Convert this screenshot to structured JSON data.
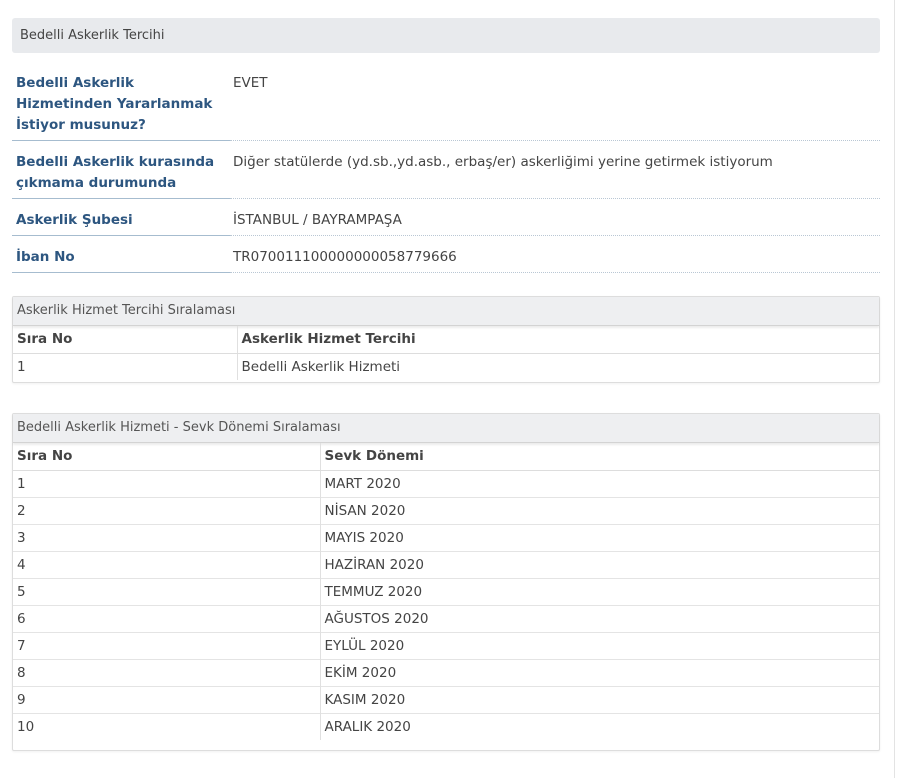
{
  "section": {
    "title": "Bedelli Askerlik Tercihi"
  },
  "fields": [
    {
      "label": "Bedelli Askerlik Hizmetinden Yararlanmak İstiyor musunuz?",
      "value": "EVET"
    },
    {
      "label": "Bedelli Askerlik kurasında çıkmama durumunda",
      "value": "Diğer statülerde (yd.sb.,yd.asb., erbaş/er) askerliğimi yerine getirmek istiyorum"
    },
    {
      "label": "Askerlik Şubesi",
      "value": "İSTANBUL / BAYRAMPAŞA"
    },
    {
      "label": "İban No",
      "value": "TR070011100000000058779666"
    }
  ],
  "service_preference": {
    "title": "Askerlik Hizmet Tercihi Sıralaması",
    "headers": [
      "Sıra No",
      "Askerlik Hizmet Tercihi"
    ],
    "rows": [
      [
        "1",
        "Bedelli Askerlik Hizmeti"
      ]
    ]
  },
  "dispatch_period": {
    "title": "Bedelli Askerlik Hizmeti - Sevk Dönemi Sıralaması",
    "headers": [
      "Sıra No",
      "Sevk Dönemi"
    ],
    "rows": [
      [
        "1",
        "MART 2020"
      ],
      [
        "2",
        "NİSAN 2020"
      ],
      [
        "3",
        "MAYIS 2020"
      ],
      [
        "4",
        "HAZİRAN 2020"
      ],
      [
        "5",
        "TEMMUZ 2020"
      ],
      [
        "6",
        "AĞUSTOS 2020"
      ],
      [
        "7",
        "EYLÜL 2020"
      ],
      [
        "8",
        "EKİM 2020"
      ],
      [
        "9",
        "KASIM 2020"
      ],
      [
        "10",
        "ARALIK 2020"
      ]
    ]
  }
}
